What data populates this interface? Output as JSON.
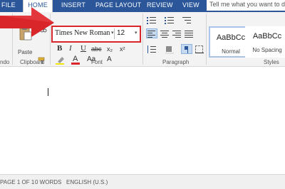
{
  "tabs": {
    "file": "FILE",
    "home": "HOME",
    "insert": "INSERT",
    "page_layout": "PAGE LAYOUT",
    "review": "REVIEW",
    "view": "VIEW"
  },
  "tell_me": "Tell me what you want to do",
  "groups": {
    "undo": "ndo",
    "clipboard": "Clipboard",
    "font": "Font",
    "paragraph": "Paragraph",
    "styles": "Styles"
  },
  "clipboard": {
    "paste_label": "Paste"
  },
  "font": {
    "name": "Times New Roman",
    "size": "12",
    "bold": "B",
    "italic": "I",
    "underline": "U",
    "strikethrough": "abc",
    "subscript": "x₂",
    "superscript": "x²",
    "font_color": "A",
    "change_case": "Aa",
    "clear_formatting": "A"
  },
  "styles": [
    {
      "sample": "AaBbCc",
      "name": "Normal"
    },
    {
      "sample": "AaBbCc",
      "name": "No Spacing"
    }
  ],
  "status": {
    "page": "PAGE 1 OF 1",
    "words": "0 WORDS",
    "language": "ENGLISH (U.S.)"
  },
  "colors": {
    "ribbon_blue": "#2b579a",
    "highlight_red": "#d9262b",
    "selected_button": "#c5d9f1"
  }
}
